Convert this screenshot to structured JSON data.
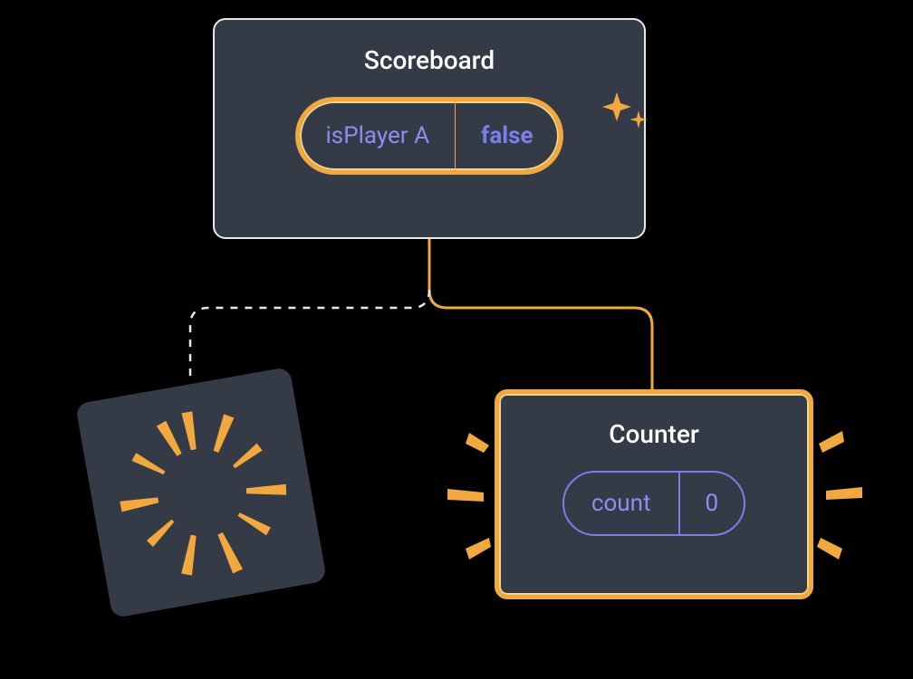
{
  "parent": {
    "title": "Scoreboard",
    "state": {
      "key": "isPlayer A",
      "value": "false"
    }
  },
  "child": {
    "title": "Counter",
    "state": {
      "key": "count",
      "value": "0"
    }
  }
}
